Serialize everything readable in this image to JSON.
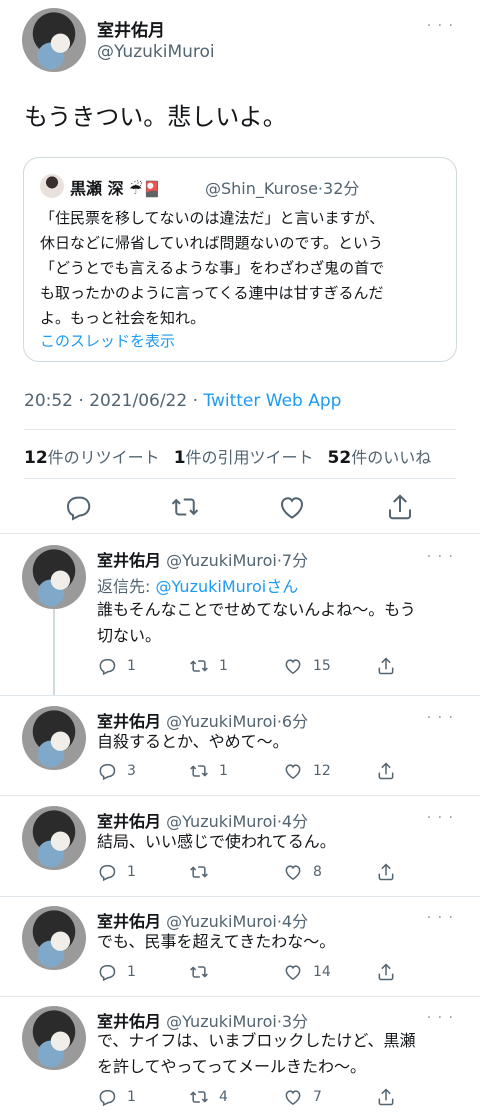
{
  "main_tweet": {
    "name": "室井佑月",
    "handle": "@YuzukiMuroi",
    "text": "もうきつい。悲しいよ。",
    "quote": {
      "name": "黒瀬 深",
      "emoji": "☔🎴",
      "handle": "@Shin_Kurose",
      "time": "32分",
      "lines": [
        "「住民票を移してないのは違法だ」と言いますが、",
        "休日などに帰省していれば問題ないのです。という",
        "「どうとでも言えるような事」をわざわざ鬼の首で",
        "も取ったかのように言ってくる連中は甘すぎるんだ",
        "よ。もっと社会を知れ。"
      ],
      "show_thread": "このスレッドを表示"
    },
    "datetime": "20:52 · 2021/06/22 · ",
    "source": "Twitter Web App",
    "stats": {
      "retweets_num": "12",
      "retweets_label": "件のリツイート",
      "quotes_num": "1",
      "quotes_label": "件の引用ツイート",
      "likes_num": "52",
      "likes_label": "件のいいね"
    },
    "more": "· · ·"
  },
  "replies": [
    {
      "name": "室井佑月",
      "handle": "@YuzukiMuroi",
      "time": "·7分",
      "reply_prefix": "返信先: ",
      "reply_to": "@YuzukiMuroiさん",
      "lines": [
        "誰もそんなことでせめてないんよね〜。もう",
        "切ない。"
      ],
      "replies": "1",
      "retweets": "1",
      "likes": "15"
    },
    {
      "name": "室井佑月",
      "handle": "@YuzukiMuroi",
      "time": "·6分",
      "lines": [
        "自殺するとか、やめて〜。"
      ],
      "replies": "3",
      "retweets": "1",
      "likes": "12"
    },
    {
      "name": "室井佑月",
      "handle": "@YuzukiMuroi",
      "time": "·4分",
      "lines": [
        "結局、いい感じで使われてるん。"
      ],
      "replies": "1",
      "retweets": "",
      "likes": "8"
    },
    {
      "name": "室井佑月",
      "handle": "@YuzukiMuroi",
      "time": "·4分",
      "lines": [
        "でも、民事を超えてきたわな〜。"
      ],
      "replies": "1",
      "retweets": "",
      "likes": "14"
    },
    {
      "name": "室井佑月",
      "handle": "@YuzukiMuroi",
      "time": "·3分",
      "lines": [
        "で、ナイフは、いまブロックしたけど、黒瀬",
        "を許してやってってメールきたわ〜。"
      ],
      "replies": "1",
      "retweets": "4",
      "likes": "7"
    }
  ],
  "icons": [
    "reply-icon",
    "retweet-icon",
    "like-icon",
    "share-icon",
    "more-icon"
  ],
  "colors": {
    "link": "#1d9bf0",
    "secondary_text": "#536471",
    "divider": "#e1e8ed"
  }
}
